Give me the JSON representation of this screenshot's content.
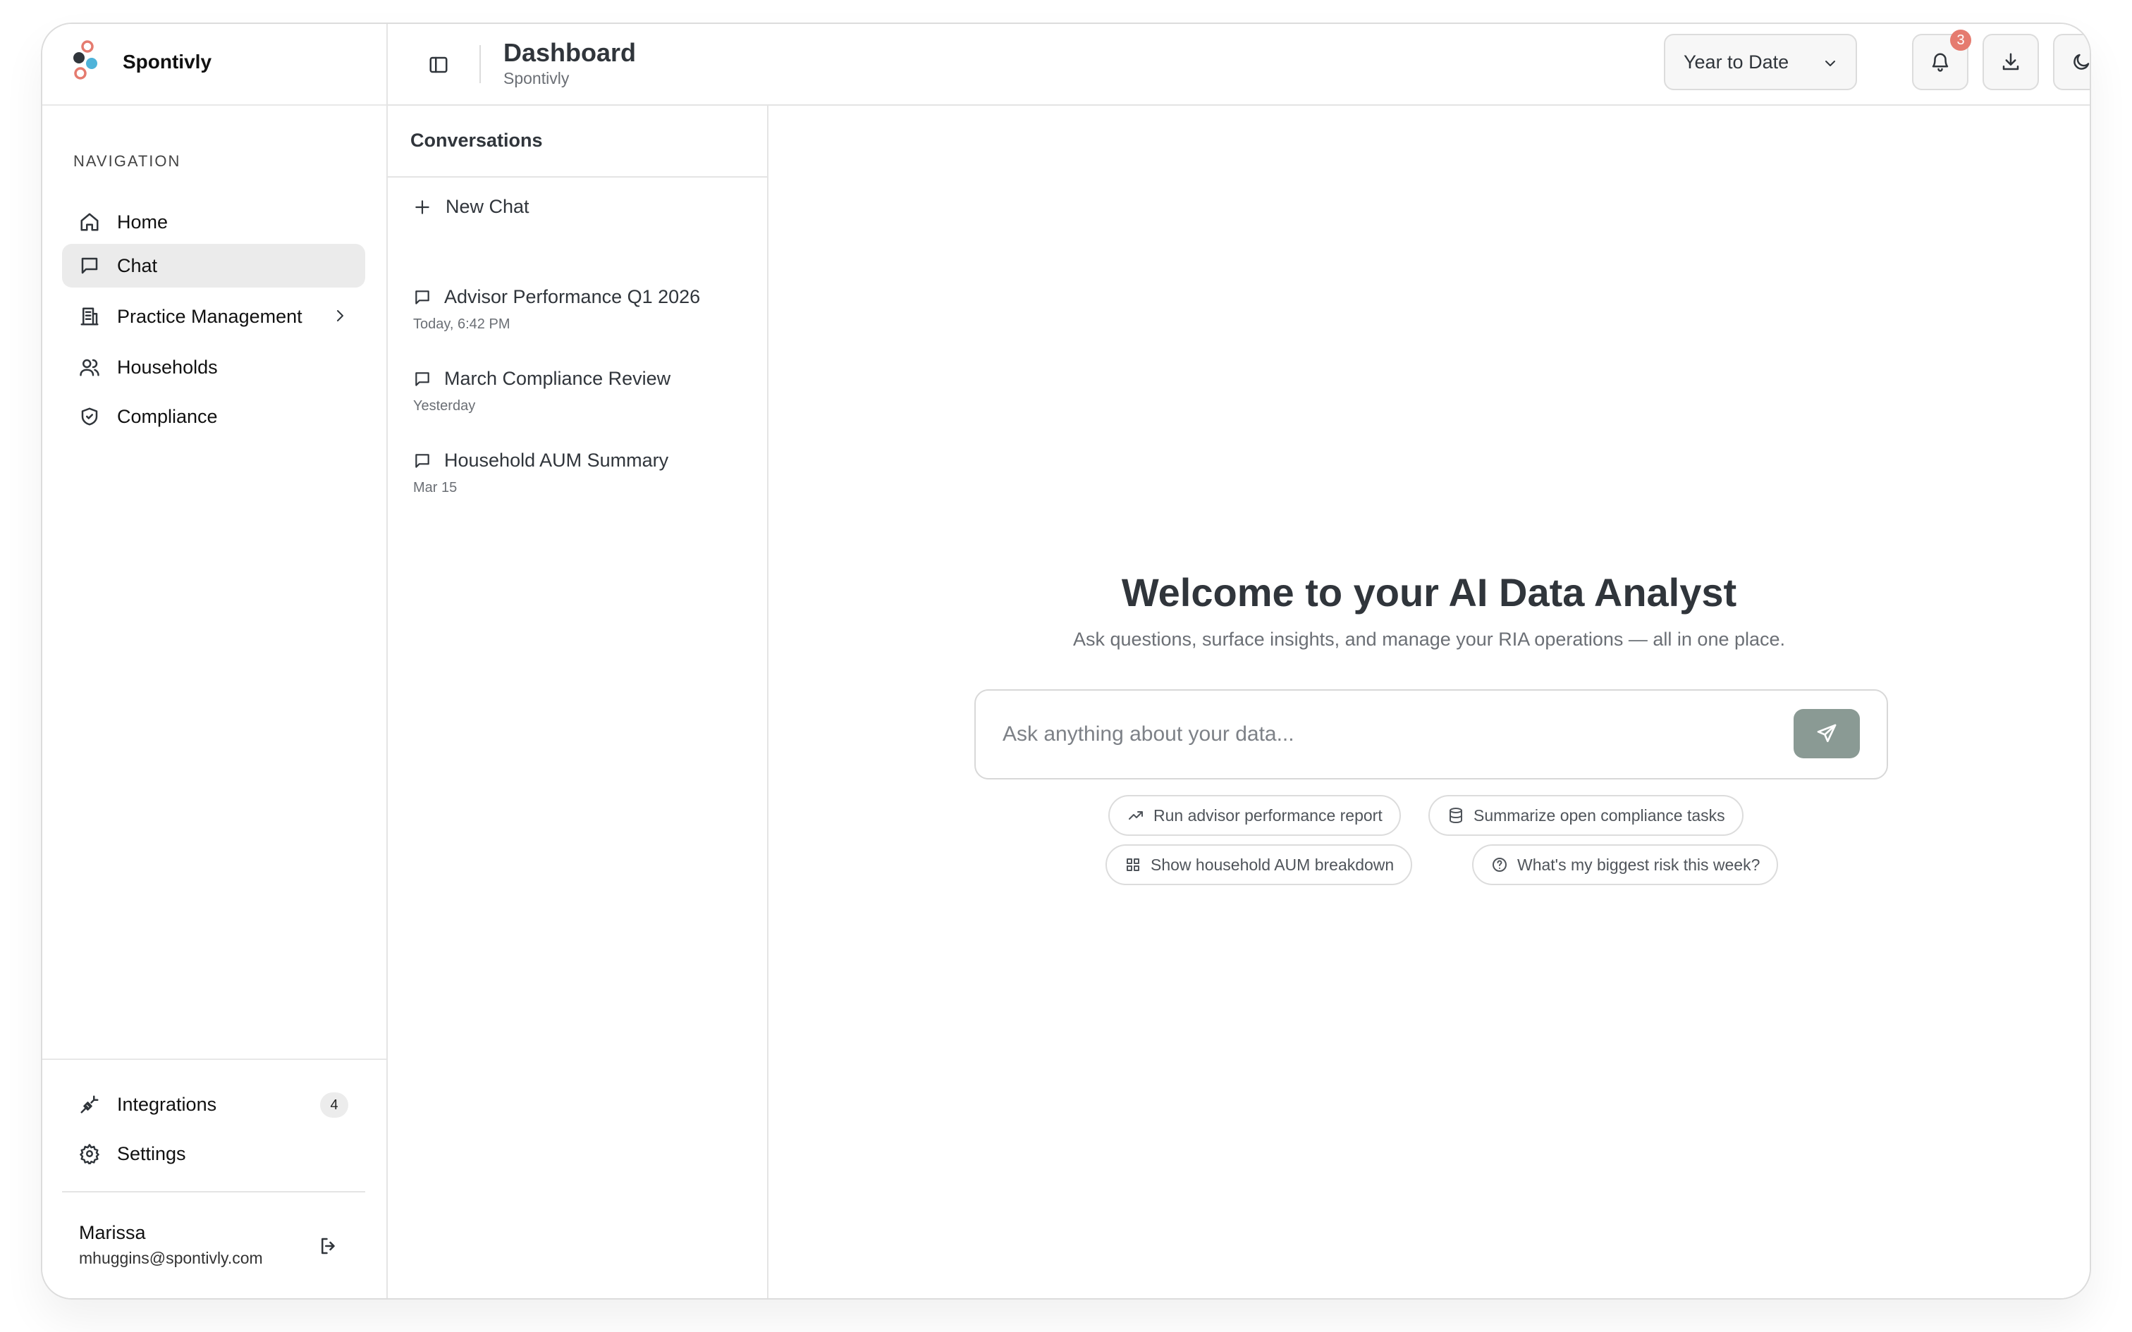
{
  "brand": {
    "name": "Spontivly",
    "logo_colors": [
      "#30353b",
      "#e57b6f",
      "#4fb3d9"
    ]
  },
  "sidebar": {
    "nav_heading": "NAVIGATION",
    "items": [
      {
        "label": "Home",
        "icon": "home-icon"
      },
      {
        "label": "Chat",
        "icon": "chat-icon",
        "active": true
      },
      {
        "label": "Practice Management",
        "icon": "building-icon",
        "has_submenu": true
      },
      {
        "label": "Households",
        "icon": "users-icon"
      },
      {
        "label": "Compliance",
        "icon": "shield-icon"
      }
    ],
    "bottom_items": [
      {
        "label": "Integrations",
        "icon": "plug-icon",
        "badge": "4"
      },
      {
        "label": "Settings",
        "icon": "gear-icon"
      }
    ],
    "user": {
      "name": "Marissa",
      "email": "mhuggins@spontivly.com"
    }
  },
  "header": {
    "title": "Dashboard",
    "subtitle": "Spontivly",
    "range_select": "Year to Date",
    "notifications_count": "3"
  },
  "conversations": {
    "title": "Conversations",
    "new_chat_label": "New Chat",
    "items": [
      {
        "title": "Advisor Performance Q1 2026",
        "time": "Today, 6:42 PM"
      },
      {
        "title": "March Compliance Review",
        "time": "Yesterday"
      },
      {
        "title": "Household AUM Summary",
        "time": "Mar 15"
      }
    ]
  },
  "main": {
    "welcome_title": "Welcome to your AI Data Analyst",
    "welcome_sub": "Ask questions, surface insights, and manage your RIA operations — all in one place.",
    "ask_placeholder": "Ask anything about your data...",
    "suggestions": [
      {
        "label": "Run advisor performance report",
        "icon": "trend-icon"
      },
      {
        "label": "Summarize open compliance tasks",
        "icon": "database-icon"
      },
      {
        "label": "Show household AUM breakdown",
        "icon": "grid-icon"
      },
      {
        "label": "What's my biggest risk this week?",
        "icon": "help-icon"
      }
    ]
  },
  "colors": {
    "accent_send": "#8a9a94",
    "active_nav": "#ebebeb",
    "notification": "#e57b6f"
  }
}
